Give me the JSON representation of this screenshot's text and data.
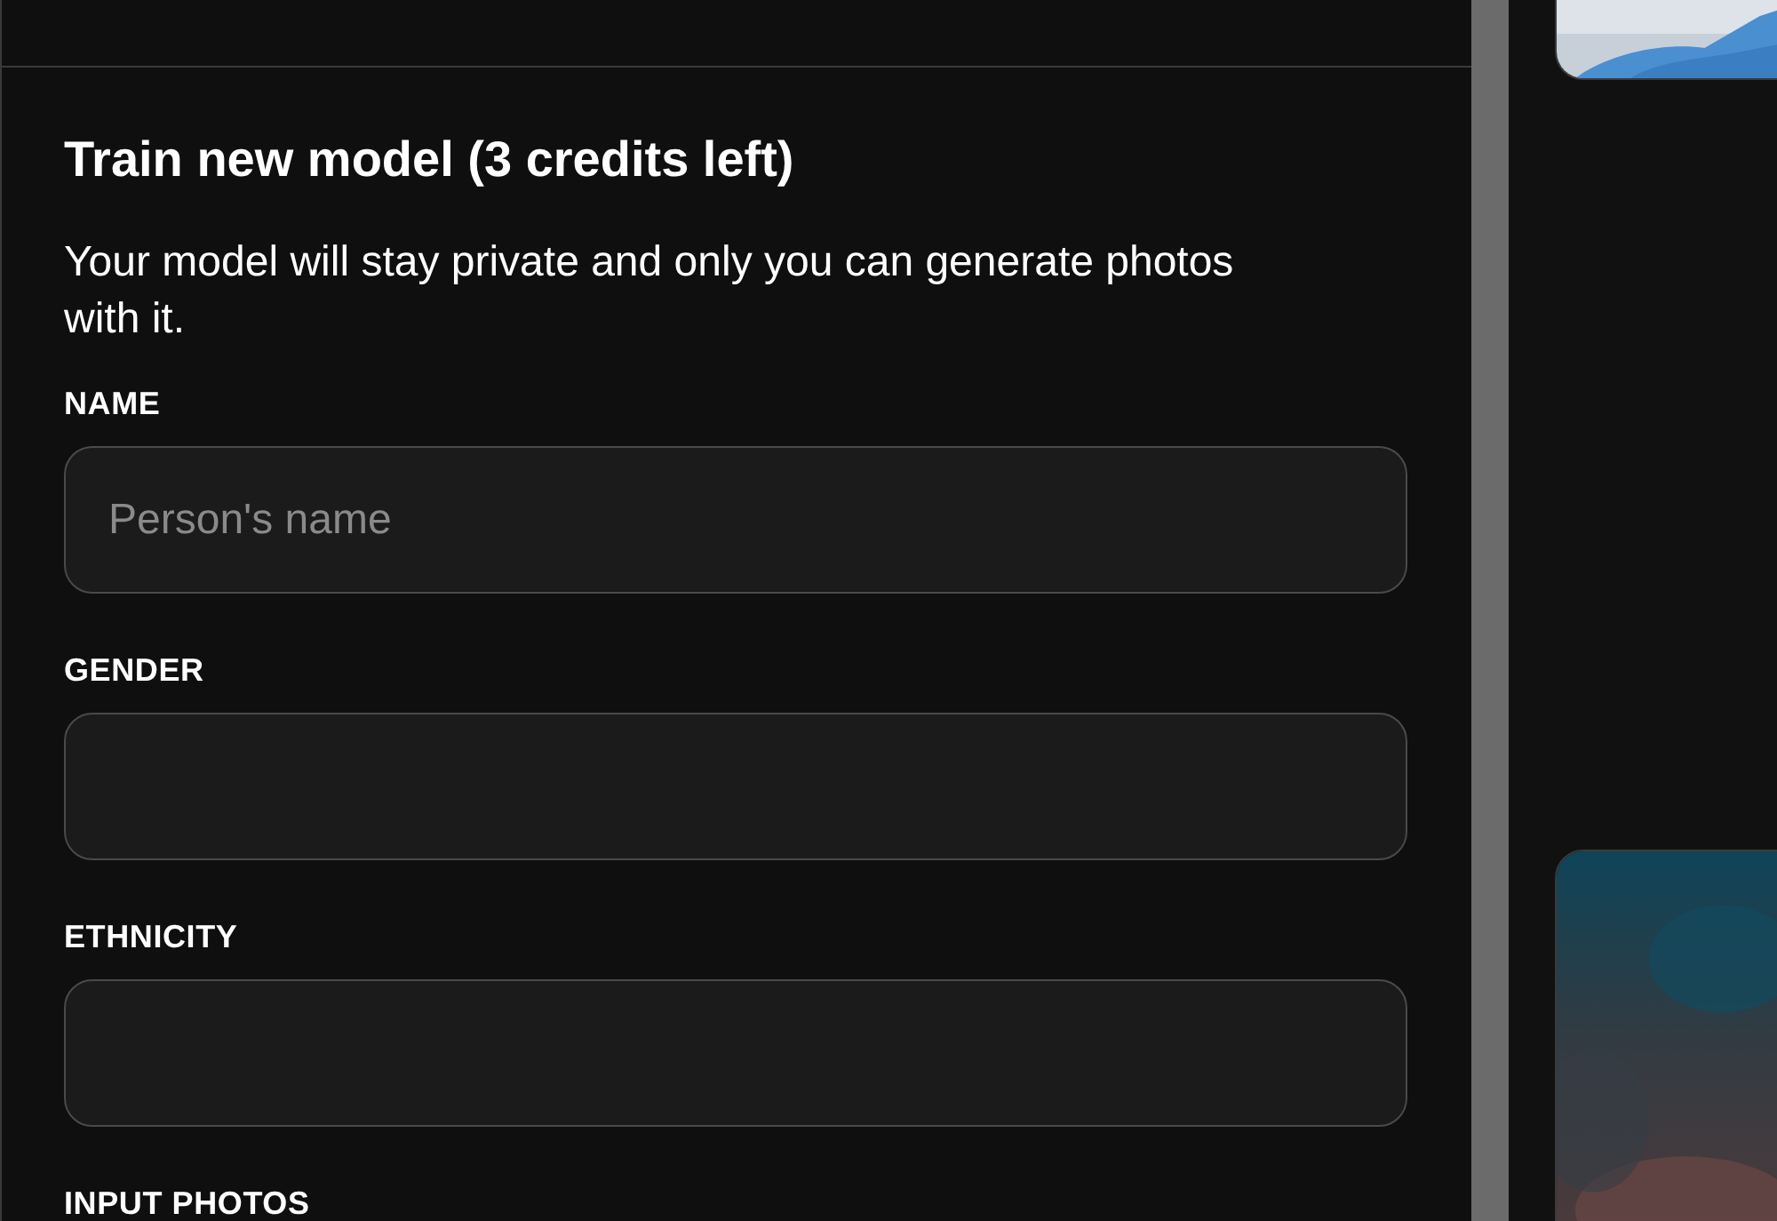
{
  "form": {
    "title": "Train new model (3 credits left)",
    "description": "Your model will stay private and only you can generate photos with it.",
    "fields": [
      {
        "label": "NAME",
        "placeholder": "Person's name"
      },
      {
        "label": "GENDER"
      },
      {
        "label": "ETHNICITY"
      }
    ],
    "next_section": "INPUT PHOTOS"
  }
}
